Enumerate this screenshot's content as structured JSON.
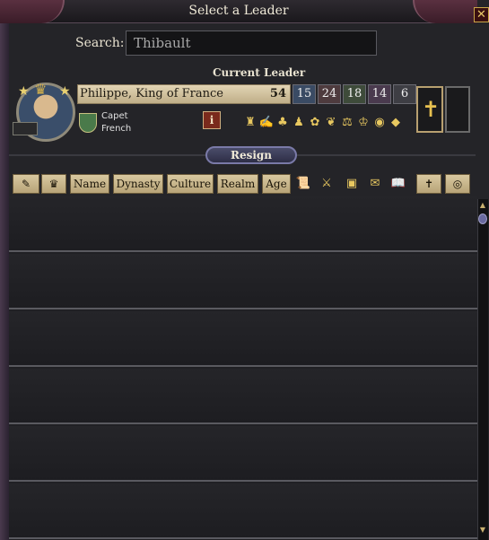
{
  "window": {
    "title": "Select a Leader",
    "close_glyph": "✕"
  },
  "search": {
    "label": "Search:",
    "value": "Thibault"
  },
  "current_leader": {
    "section_label": "Current Leader",
    "name": "Philippe, King of France",
    "age": "54",
    "stats": {
      "diplomacy": "15",
      "martial": "24",
      "stewardship": "18",
      "intrigue": "14",
      "learning": "6"
    },
    "dynasty": "Capet",
    "culture": "French",
    "info_glyph": "i",
    "religion_glyph": "✝",
    "traits": [
      "trait-icon",
      "trait-icon",
      "trait-icon",
      "trait-icon",
      "trait-icon",
      "trait-icon",
      "trait-icon",
      "trait-icon",
      "trait-icon",
      "trait-icon"
    ]
  },
  "resign_button": "Resign",
  "columns": {
    "name": "Name",
    "dynasty": "Dynasty",
    "culture": "Culture",
    "realm": "Realm",
    "age": "Age"
  },
  "icons": {
    "quill": "✎",
    "crown": "♛",
    "scroll": "📜",
    "swords": "⚔",
    "chest": "▣",
    "letter": "✉",
    "book": "📖",
    "cross": "✝",
    "glasses": "◎"
  },
  "colors": {
    "accent": "#c9a648",
    "button": "#3a3c5a"
  }
}
